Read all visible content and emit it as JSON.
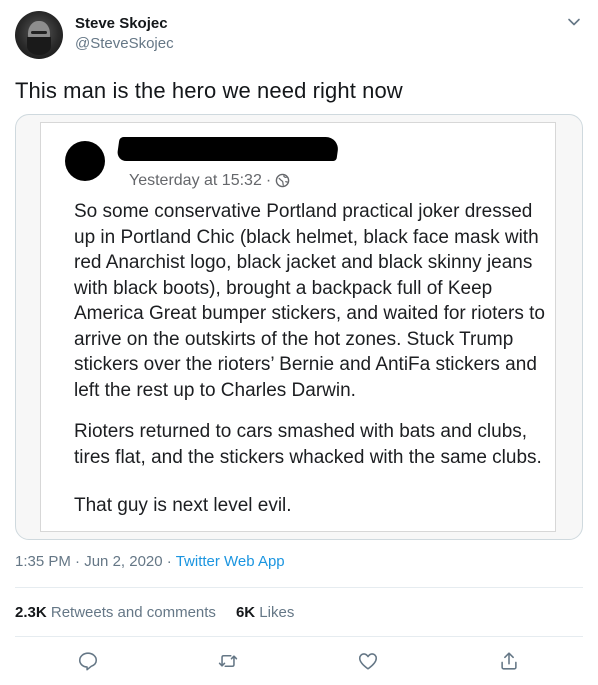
{
  "user": {
    "name": "Steve Skojec",
    "handle": "@SteveSkojec"
  },
  "tweet": {
    "text": "This man is the hero we need right now"
  },
  "embedded_post": {
    "timestamp": "Yesterday at 15:32",
    "separator": "·",
    "paragraph1": [
      "So some conservative Portland practical joker dressed",
      "up in Portland Chic (black helmet, black face mask with",
      "red Anarchist logo, black jacket and black skinny jeans",
      "with black boots), brought a backpack full of Keep",
      "America Great bumper stickers, and waited for rioters to",
      "arrive on the outskirts of the hot zones. Stuck Trump",
      "stickers over the rioters’ Bernie and AntiFa stickers and",
      "left the rest up to Charles Darwin."
    ],
    "paragraph2": [
      "Rioters returned to cars smashed with bats and clubs,",
      "tires flat, and the stickers whacked with the same clubs."
    ],
    "paragraph3": [
      "That guy is next level evil."
    ]
  },
  "meta": {
    "time": "1:35 PM",
    "separator1": "·",
    "date": "Jun 2, 2020",
    "separator2": "·",
    "app": "Twitter Web App"
  },
  "stats": {
    "retweets_count": "2.3K",
    "retweets_label": "Retweets and comments",
    "likes_count": "6K",
    "likes_label": "Likes"
  },
  "icons": {
    "chevron": "chevron-down-icon",
    "globe": "globe-icon",
    "reply": "reply-icon",
    "retweet": "retweet-icon",
    "like": "heart-icon",
    "share": "share-icon"
  },
  "colors": {
    "link": "#1b95e0",
    "secondary_text": "#657786",
    "icon": "#657786",
    "divider": "#e6ecf0"
  }
}
